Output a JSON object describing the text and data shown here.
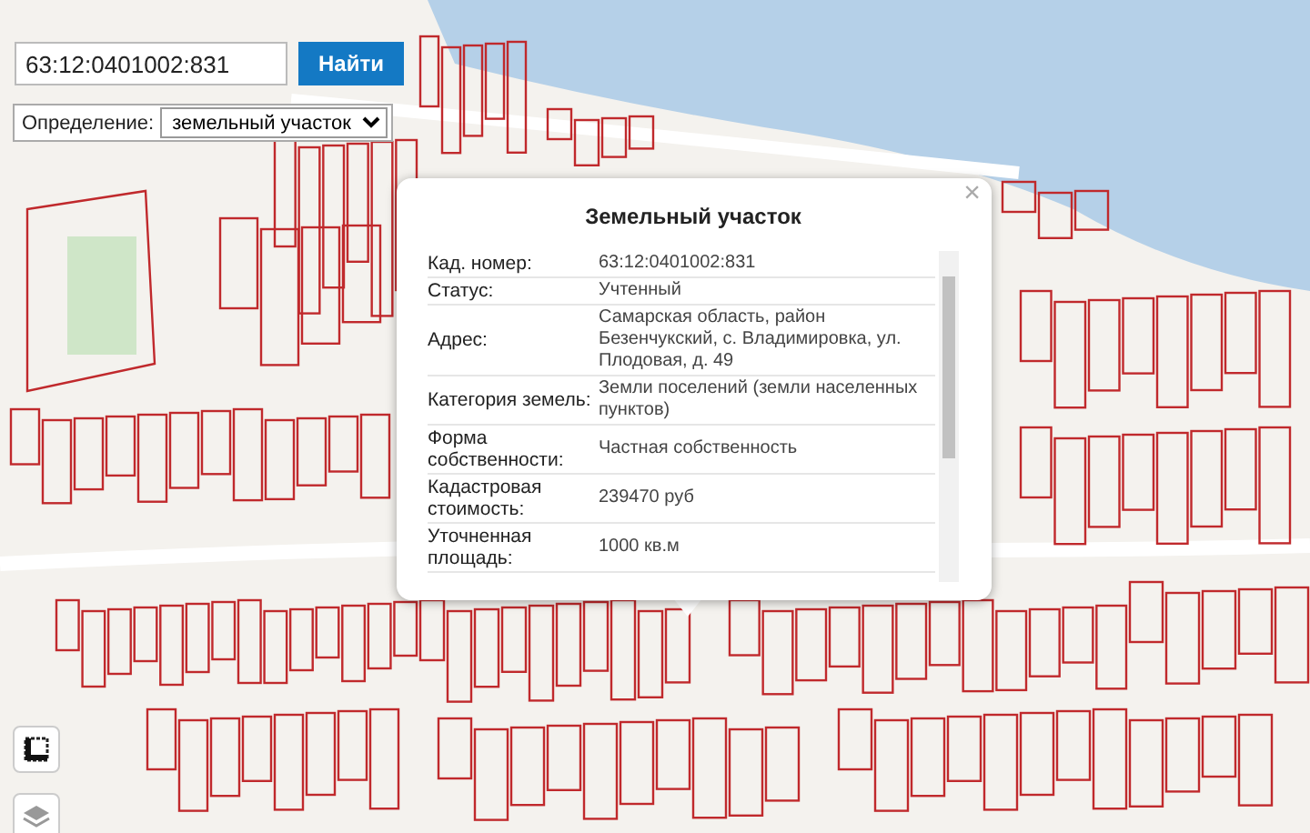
{
  "search": {
    "value": "63:12:0401002:831",
    "button": "Найти"
  },
  "definition": {
    "label": "Определение:",
    "value": "земельный участок"
  },
  "popup": {
    "title": "Земельный участок",
    "close": "×",
    "rows": [
      {
        "label": "Кад. номер:",
        "value": "63:12:0401002:831"
      },
      {
        "label": "Статус:",
        "value": "Учтенный"
      },
      {
        "label": "Адрес:",
        "value": "Самарская область, район Безенчукский, с. Владимировка, ул. Плодовая, д. 49"
      },
      {
        "label": "Категория земель:",
        "value": "Земли поселений (земли населенных пунктов)"
      },
      {
        "label": "Форма собственности:",
        "value": "Частная собственность"
      },
      {
        "label": "Кадастровая стоимость:",
        "value": "239470 руб"
      },
      {
        "label": "Уточненная площадь:",
        "value": "1000 кв.м"
      }
    ]
  }
}
